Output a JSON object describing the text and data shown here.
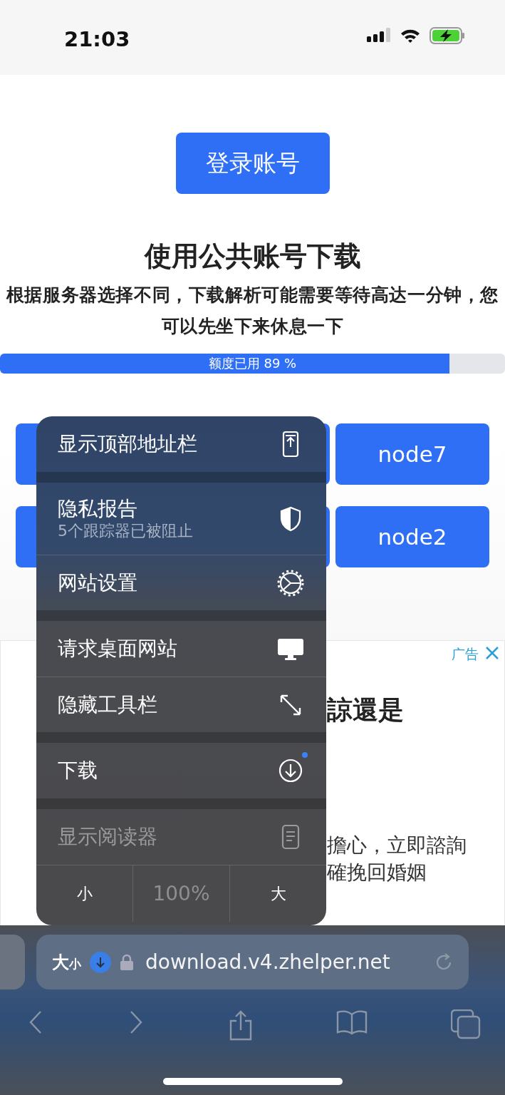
{
  "status_bar": {
    "time": "21:03"
  },
  "page": {
    "login_button": "登录账号",
    "public_heading": "使用公共账号下载",
    "notice": "根据服务器选择不同，下载解析可能需要等待高达一分钟，您可以先坐下来休息一下",
    "quota": {
      "label": "额度已用 89 %",
      "level": 0.89
    },
    "node_rows": [
      [
        "node7"
      ],
      [
        "node2"
      ]
    ],
    "ad": {
      "label": "广告",
      "title_fragment": "諒還是",
      "body_fragments": [
        "擔心，立即諮詢",
        "確挽回婚姻"
      ]
    }
  },
  "menu": {
    "groups": [
      [
        {
          "label": "显示顶部地址栏",
          "disabled": false,
          "dot": false
        }
      ],
      [
        {
          "label": "隐私报告",
          "subtitle": "5个跟踪器已被阻止",
          "disabled": false,
          "dot": false
        },
        {
          "label": "网站设置",
          "disabled": false,
          "dot": false
        }
      ],
      [
        {
          "label": "请求桌面网站",
          "disabled": false,
          "dot": false
        },
        {
          "label": "隐藏工具栏",
          "disabled": false,
          "dot": false
        }
      ],
      [
        {
          "label": "下载",
          "disabled": false,
          "dot": true
        }
      ],
      [
        {
          "label": "显示阅读器",
          "disabled": true,
          "dot": false
        }
      ]
    ],
    "zoom": [
      {
        "label": "小",
        "disabled": false
      },
      {
        "label": "100%",
        "disabled": true
      },
      {
        "label": "大",
        "disabled": false
      }
    ]
  },
  "toolbar": {
    "text_size": {
      "big": "大",
      "small": "小"
    },
    "url": "download.v4.zhelper.net",
    "download_badge": true
  }
}
